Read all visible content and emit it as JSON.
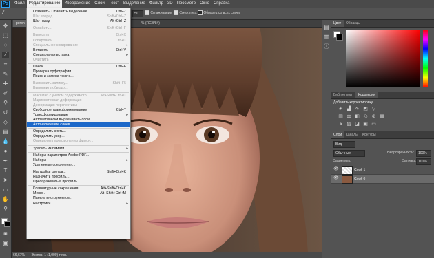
{
  "menubar": {
    "logo": "Ps",
    "items": [
      "Файл",
      "Редактирование",
      "Изображение",
      "Слои",
      "Текст",
      "Выделение",
      "Фильтр",
      "3D",
      "Просмотр",
      "Окно",
      "Справка"
    ],
    "active_index": 1
  },
  "options": {
    "value": "50",
    "antialias": "Сглаживание",
    "refine": "Смеж.пикс.",
    "all_layers": "Образец со всех слоев"
  },
  "document": {
    "tab": "peron",
    "tab_suffix": "% (RGB/8#)",
    "zoom": "66,67%",
    "status": "Экспоз. 1 (1,000) точн."
  },
  "edit_menu": [
    {
      "label": "Отменить: Отменить выделение",
      "shortcut": "Ctrl+Z",
      "disabled": false
    },
    {
      "label": "Шаг вперед",
      "shortcut": "Shift+Ctrl+Z",
      "disabled": true
    },
    {
      "label": "Шаг назад",
      "shortcut": "Alt+Ctrl+Z",
      "disabled": false
    },
    {
      "sep": true
    },
    {
      "label": "Ослабить...",
      "shortcut": "Shift+Ctrl+F",
      "disabled": true
    },
    {
      "sep": true
    },
    {
      "label": "Вырезать",
      "shortcut": "Ctrl+X",
      "disabled": true
    },
    {
      "label": "Копировать",
      "shortcut": "Ctrl+C",
      "disabled": true
    },
    {
      "label": "Специальное копирование",
      "shortcut": "",
      "disabled": true,
      "submenu": true
    },
    {
      "label": "Вставить",
      "shortcut": "Ctrl+V",
      "disabled": false
    },
    {
      "label": "Специальная вставка",
      "shortcut": "",
      "disabled": false,
      "submenu": true
    },
    {
      "label": "Очистить",
      "shortcut": "",
      "disabled": true
    },
    {
      "sep": true
    },
    {
      "label": "Поиск",
      "shortcut": "Ctrl+F",
      "disabled": false
    },
    {
      "label": "Проверка орфографии...",
      "shortcut": "",
      "disabled": false
    },
    {
      "label": "Поиск и замена текста...",
      "shortcut": "",
      "disabled": false
    },
    {
      "sep": true
    },
    {
      "label": "Выполнить заливку...",
      "shortcut": "Shift+F5",
      "disabled": true
    },
    {
      "label": "Выполнить обводку...",
      "shortcut": "",
      "disabled": true
    },
    {
      "sep": true
    },
    {
      "label": "Масштаб с учетом содержимого",
      "shortcut": "Alt+Shift+Ctrl+C",
      "disabled": true
    },
    {
      "label": "Марионеточная деформация",
      "shortcut": "",
      "disabled": true
    },
    {
      "label": "Деформация перспективы",
      "shortcut": "",
      "disabled": true
    },
    {
      "label": "Свободное трансформирование",
      "shortcut": "Ctrl+T",
      "disabled": false
    },
    {
      "label": "Трансформирование",
      "shortcut": "",
      "disabled": false,
      "submenu": true
    },
    {
      "label": "Автоматически выравнивать слои...",
      "shortcut": "",
      "disabled": false
    },
    {
      "label": "Автоналожение слоев...",
      "shortcut": "",
      "disabled": false,
      "highlight": true
    },
    {
      "sep": true
    },
    {
      "label": "Определить кисть...",
      "shortcut": "",
      "disabled": false
    },
    {
      "label": "Определить узор...",
      "shortcut": "",
      "disabled": false
    },
    {
      "label": "Определить произвольную фигуру...",
      "shortcut": "",
      "disabled": true
    },
    {
      "sep": true
    },
    {
      "label": "Удалить из памяти",
      "shortcut": "",
      "disabled": false,
      "submenu": true
    },
    {
      "sep": true
    },
    {
      "label": "Наборы параметров Adobe PDF...",
      "shortcut": "",
      "disabled": false
    },
    {
      "label": "Наборы",
      "shortcut": "",
      "disabled": false,
      "submenu": true
    },
    {
      "label": "Удаленные соединения...",
      "shortcut": "",
      "disabled": false
    },
    {
      "sep": true
    },
    {
      "label": "Настройки цветов...",
      "shortcut": "Shift+Ctrl+K",
      "disabled": false
    },
    {
      "label": "Назначить профиль...",
      "shortcut": "",
      "disabled": false
    },
    {
      "label": "Преобразовать в профиль...",
      "shortcut": "",
      "disabled": false
    },
    {
      "sep": true
    },
    {
      "label": "Клавиатурные сокращения...",
      "shortcut": "Alt+Shift+Ctrl+K",
      "disabled": false
    },
    {
      "label": "Меню...",
      "shortcut": "Alt+Shift+Ctrl+M",
      "disabled": false
    },
    {
      "label": "Панель инструментов...",
      "shortcut": "",
      "disabled": false
    },
    {
      "label": "Настройки",
      "shortcut": "",
      "disabled": false,
      "submenu": true
    }
  ],
  "color_panel": {
    "tab_color": "Цвет",
    "tab_swatches": "Образцы"
  },
  "adjust_panel": {
    "tab_libraries": "Библиотеки",
    "tab_corrections": "Коррекция",
    "title": "Добавить корректировку"
  },
  "layers_panel": {
    "tab_layers": "Слои",
    "tab_channels": "Каналы",
    "tab_paths": "Контуры",
    "filter": "Вид",
    "blend": "Обычные",
    "opacity_label": "Непрозрачность:",
    "opacity": "100%",
    "lock_label": "Закрепить:",
    "fill_label": "Заливка:",
    "fill": "100%",
    "layers": [
      {
        "name": "Слой 1"
      },
      {
        "name": "Слой 0"
      }
    ]
  },
  "colors": {
    "accent": "#1c68c9",
    "menu_bg": "#f0f0f0",
    "panel": "#535353"
  }
}
